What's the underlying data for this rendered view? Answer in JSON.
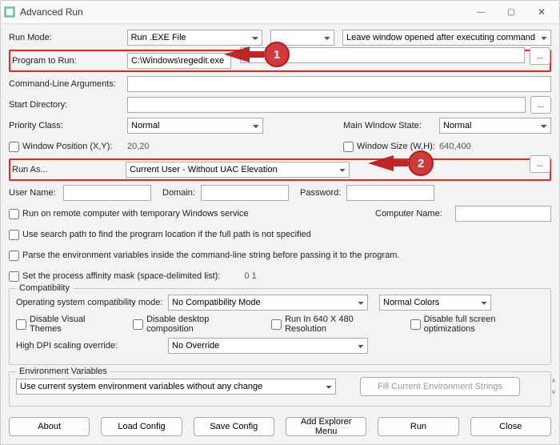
{
  "window": {
    "title": "Advanced Run"
  },
  "runMode": {
    "label": "Run Mode:",
    "value": "Run .EXE File",
    "rightValue": "Leave window opened after executing command"
  },
  "programToRun": {
    "label": "Program to Run:",
    "value": "C:\\Windows\\regedit.exe"
  },
  "cmdArgs": {
    "label": "Command-Line Arguments:"
  },
  "startDir": {
    "label": "Start Directory:"
  },
  "priority": {
    "label": "Priority Class:",
    "value": "Normal"
  },
  "mainWinState": {
    "label": "Main Window State:",
    "value": "Normal"
  },
  "winPos": {
    "label": "Window Position (X,Y):",
    "value": "20,20"
  },
  "winSize": {
    "label": "Window Size (W,H):",
    "value": "640,400"
  },
  "runAs": {
    "label": "Run As...",
    "value": "Current User - Without UAC Elevation"
  },
  "userName": {
    "label": "User Name:"
  },
  "domain": {
    "label": "Domain:"
  },
  "password": {
    "label": "Password:"
  },
  "remote": {
    "check": "Run on remote computer with temporary Windows service",
    "compNameLabel": "Computer Name:"
  },
  "searchPath": "Use search path to find the program location if the full path is not specified",
  "parseEnv": "Parse the environment variables inside the command-line string before passing it to the program.",
  "affinity": {
    "label": "Set the process affinity mask (space-delimited list):",
    "value": "0 1"
  },
  "compat": {
    "title": "Compatibility",
    "osModeLabel": "Operating system compatibility mode:",
    "osModeValue": "No Compatibility Mode",
    "colorsValue": "Normal Colors",
    "disableThemes": "Disable Visual Themes",
    "disableComp": "Disable desktop composition",
    "run640": "Run In 640 X 480 Resolution",
    "disableFS": "Disable full screen optimizations",
    "dpiLabel": "High DPI scaling override:",
    "dpiValue": "No Override"
  },
  "envVars": {
    "title": "Environment Variables",
    "modeValue": "Use current system environment variables without any change",
    "fillBtn": "Fill Current Environment Strings"
  },
  "buttons": {
    "about": "About",
    "loadCfg": "Load Config",
    "saveCfg": "Save Config",
    "addExplorer": "Add Explorer Menu",
    "run": "Run",
    "close": "Close"
  },
  "callouts": {
    "one": "1",
    "two": "2"
  }
}
